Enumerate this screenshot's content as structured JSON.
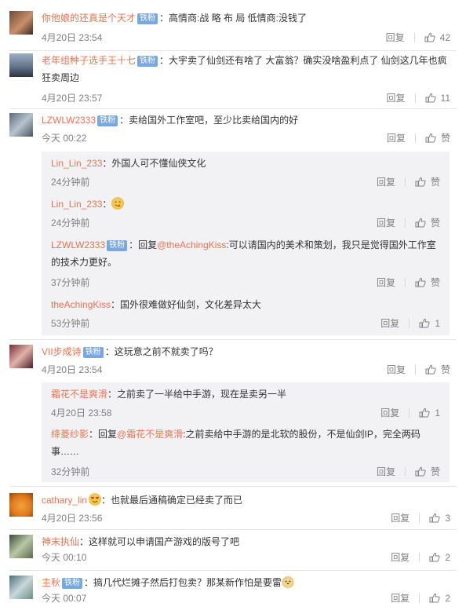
{
  "badge_label": "铁粉",
  "reply_label": "回复",
  "like_label_default": "赞",
  "comments": [
    {
      "user": "你他娘的还真是个天才",
      "has_badge": true,
      "text": "：高情商:战 略 布 局 低情商:没钱了",
      "time": "4月20日 23:54",
      "likes": "42"
    },
    {
      "user": "老年组种子选手王十七",
      "has_badge": true,
      "text": "：大宇卖了仙剑还有啥了 大富翁？确实没啥盈利点了 仙剑这几年也疯狂卖周边",
      "time": "4月20日 23:57",
      "likes": "11"
    },
    {
      "user": "LZWLW2333",
      "has_badge": true,
      "text": "：卖给国外工作室吧，至少比卖给国内的好",
      "time": "今天 00:22",
      "likes": "赞",
      "replies": [
        {
          "user": "Lin_Lin_233",
          "text": "：外国人可不懂仙侠文化",
          "time": "24分钟前",
          "likes": "赞"
        },
        {
          "user": "Lin_Lin_233",
          "text": "：",
          "time": "24分钟前",
          "likes": "赞"
        },
        {
          "user": "LZWLW2333",
          "has_badge": true,
          "text_pre": "：回复",
          "at": "@theAchingKiss",
          "text": ":可以请国内的美术和策划，我只是觉得国外工作室的技术力更好。",
          "time": "37分钟前",
          "likes": "赞"
        },
        {
          "user": "theAchingKiss",
          "text": "：国外很难做好仙剑，文化差异太大",
          "time": "53分钟前",
          "likes": "1"
        }
      ]
    },
    {
      "user": "VII步成诗",
      "has_badge": true,
      "text": "：这玩意之前不就卖了吗？",
      "time": "4月20日 23:54",
      "likes": "赞",
      "replies": [
        {
          "user": "霜花不是爽滑",
          "text": "：之前卖了一半给中手游，现在是卖另一半",
          "time": "4月20日 23:58",
          "likes": "1"
        },
        {
          "user": "绛菱纱影",
          "text_pre": "：回复",
          "at": "@霜花不是爽滑",
          "text": ":之前卖给中手游的是北软的股份，不是仙剑IP，完全两码事……",
          "time": "32分钟前",
          "likes": "赞"
        }
      ]
    },
    {
      "user": "cathary_lin",
      "has_badge": false,
      "text": "：也就最后通稿确定已经卖了而已",
      "time": "4月20日 23:56",
      "likes": "3"
    },
    {
      "user": "神末执仙",
      "has_badge": false,
      "text": "：这样就可以申请国产游戏的版号了吧",
      "time": "今天 00:10",
      "likes": "2"
    },
    {
      "user": "主秋",
      "has_badge": true,
      "text": "：搞几代烂摊子然后打包卖？那某新作怕是要雷",
      "time": "今天 00:07",
      "likes": "2"
    }
  ]
}
